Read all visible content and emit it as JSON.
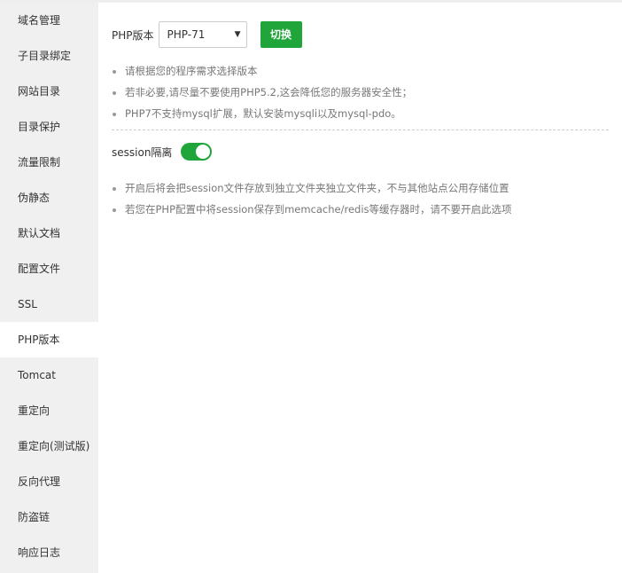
{
  "sidebar": {
    "items": [
      {
        "label": "域名管理"
      },
      {
        "label": "子目录绑定"
      },
      {
        "label": "网站目录"
      },
      {
        "label": "目录保护"
      },
      {
        "label": "流量限制"
      },
      {
        "label": "伪静态"
      },
      {
        "label": "默认文档"
      },
      {
        "label": "配置文件"
      },
      {
        "label": "SSL"
      },
      {
        "label": "PHP版本"
      },
      {
        "label": "Tomcat"
      },
      {
        "label": "重定向"
      },
      {
        "label": "重定向(测试版)"
      },
      {
        "label": "反向代理"
      },
      {
        "label": "防盗链"
      },
      {
        "label": "响应日志"
      }
    ],
    "active_item": "PHP版本"
  },
  "php": {
    "label": "PHP版本",
    "selected": "PHP-71",
    "caret": "▼",
    "switch_label": "切换",
    "tips": [
      "请根据您的程序需求选择版本",
      "若非必要,请尽量不要使用PHP5.2,这会降低您的服务器安全性；",
      "PHP7不支持mysql扩展，默认安装mysqli以及mysql-pdo。"
    ]
  },
  "session": {
    "label": "session隔离",
    "enabled": true,
    "tips": [
      "开启后将会把session文件存放到独立文件夹独立文件夹，不与其他站点公用存储位置",
      "若您在PHP配置中将session保存到memcache/redis等缓存器时，请不要开启此选项"
    ]
  },
  "colors": {
    "accent": "#20a53a",
    "sidebar_bg": "#f0f0f0",
    "active_item_bg": "#ffffff"
  }
}
